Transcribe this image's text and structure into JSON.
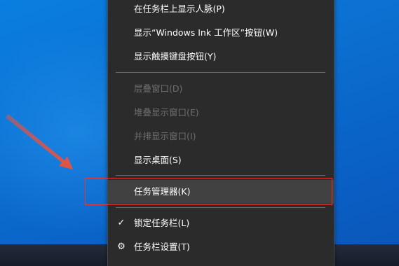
{
  "context_menu": {
    "items": [
      {
        "label": "在任务栏上显示人脉(P)",
        "enabled": true
      },
      {
        "label": "显示“Windows Ink 工作区”按钮(W)",
        "enabled": true
      },
      {
        "label": "显示触摸键盘按钮(Y)",
        "enabled": true
      },
      {
        "label": "层叠窗口(D)",
        "enabled": false
      },
      {
        "label": "堆叠显示窗口(E)",
        "enabled": false
      },
      {
        "label": "并排显示窗口(I)",
        "enabled": false
      },
      {
        "label": "显示桌面(S)",
        "enabled": true
      },
      {
        "label": "任务管理器(K)",
        "enabled": true,
        "highlighted": true
      },
      {
        "label": "锁定任务栏(L)",
        "enabled": true,
        "checked": true
      },
      {
        "label": "任务栏设置(T)",
        "enabled": true,
        "icon": "gear-icon"
      }
    ]
  },
  "icons": {
    "check": "✓",
    "gear": "⚙"
  },
  "colors": {
    "menu_background": "#2b2b2b",
    "menu_highlight": "#414141",
    "menu_text": "#ffffff",
    "menu_text_disabled": "#6f6f6f",
    "annotation_red": "#e33a3a",
    "desktop_blue": "#0b6fd0",
    "taskbar": "#1c2431"
  }
}
